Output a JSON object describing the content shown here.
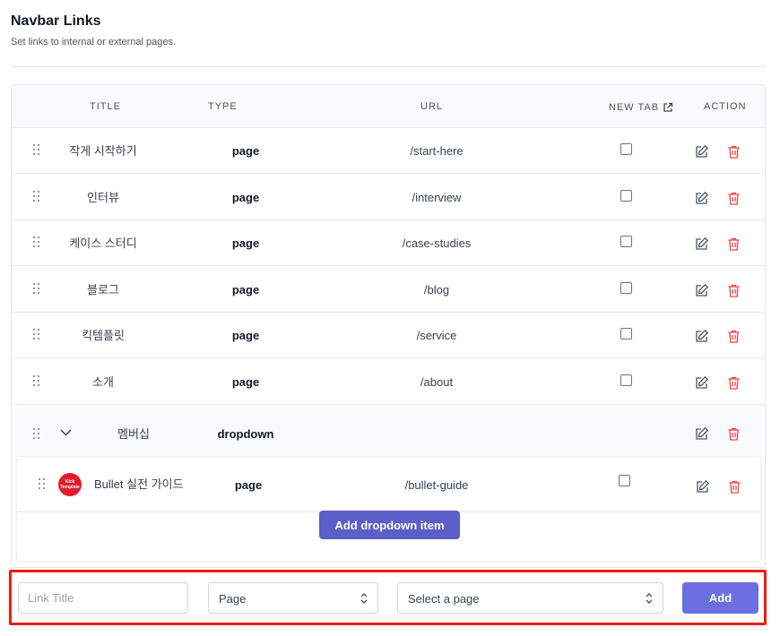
{
  "header": {
    "title": "Navbar Links",
    "subtitle": "Set links to internal or external pages."
  },
  "table": {
    "columns": {
      "title": "TITLE",
      "type": "TYPE",
      "url": "URL",
      "new_tab": "NEW TAB",
      "action": "ACTION"
    },
    "rows": [
      {
        "title": "작게 시작하기",
        "type": "page",
        "url": "/start-here",
        "new_tab": false
      },
      {
        "title": "인터뷰",
        "type": "page",
        "url": "/interview",
        "new_tab": false
      },
      {
        "title": "케이스 스터디",
        "type": "page",
        "url": "/case-studies",
        "new_tab": false
      },
      {
        "title": "블로그",
        "type": "page",
        "url": "/blog",
        "new_tab": false
      },
      {
        "title": "킥템플릿",
        "type": "page",
        "url": "/service",
        "new_tab": false
      },
      {
        "title": "소개",
        "type": "page",
        "url": "/about",
        "new_tab": false
      }
    ],
    "dropdown": {
      "title": "멤버십",
      "type": "dropdown",
      "expanded": true,
      "items": [
        {
          "title": "Bullet 실전 가이드",
          "type": "page",
          "url": "/bullet-guide",
          "new_tab": false,
          "avatar_text": "Kick Template"
        }
      ],
      "add_item_label": "Add dropdown item"
    }
  },
  "form": {
    "link_title_placeholder": "Link Title",
    "type_value": "Page",
    "page_placeholder": "Select a page",
    "add_label": "Add"
  },
  "colors": {
    "primary": "#6366d6",
    "delete": "#ef4444",
    "highlight": "#ee1c0b"
  },
  "icons": {
    "drag": "drag-handle-icon",
    "edit": "edit-icon",
    "delete": "trash-icon",
    "external": "external-link-icon",
    "chevron": "chevron-down-icon",
    "updown": "chevron-up-down-icon"
  }
}
